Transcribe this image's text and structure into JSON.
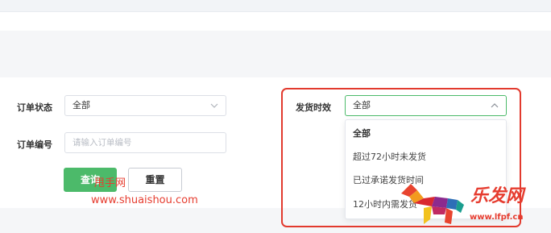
{
  "filters": {
    "order_status": {
      "label": "订单状态",
      "value": "全部"
    },
    "order_no": {
      "label": "订单编号",
      "placeholder": "请输入订单编号"
    },
    "ship_time": {
      "label": "发货时效",
      "value": "全部"
    }
  },
  "buttons": {
    "query": "查询",
    "reset": "重置"
  },
  "dropdown": {
    "options": [
      "全部",
      "超过72小时未发货",
      "已过承诺发货时间",
      "12小时内需发货"
    ]
  },
  "watermarks": {
    "left_cn": "甩手网",
    "left_url": "www.shuaishou.com",
    "right_cn": "乐发网",
    "right_url": "www.lfpf.cn"
  },
  "colors": {
    "accent": "#4cba6a",
    "highlight": "#e23a2e",
    "watermark": "#e63c2f"
  }
}
